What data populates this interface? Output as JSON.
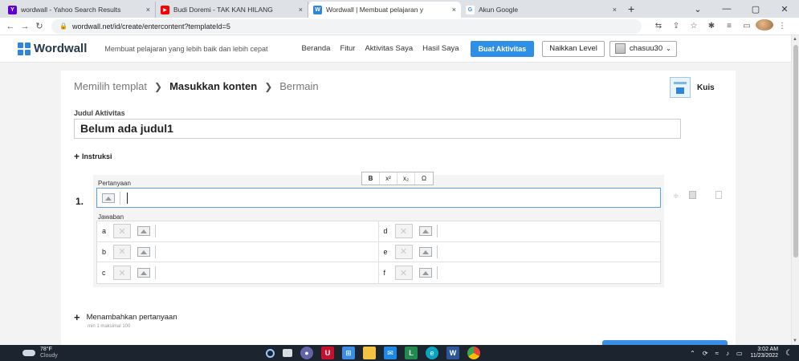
{
  "browser": {
    "tabs": [
      {
        "title": "wordwall - Yahoo Search Results",
        "fav_color": "#5f01d1",
        "fav_glyph": "Y"
      },
      {
        "title": "Budi Doremi - TAK KAN HILANG",
        "fav_color": "#ff0000",
        "fav_glyph": "▶"
      },
      {
        "title": "Wordwall | Membuat pelajaran y",
        "fav_color": "#2f86d9",
        "fav_glyph": "W",
        "active": true
      },
      {
        "title": "Akun Google",
        "fav_color": "#ffffff",
        "fav_glyph": "G"
      }
    ],
    "close_glyph": "×",
    "new_tab_glyph": "+",
    "url": "wordwall.net/id/create/entercontent?templateId=5",
    "window_controls": [
      "⌄",
      "—",
      "▢",
      "✕"
    ]
  },
  "header": {
    "logo": "Wordwall",
    "tagline": "Membuat pelajaran yang lebih baik dan lebih cepat",
    "nav": [
      "Beranda",
      "Fitur",
      "Aktivitas Saya",
      "Hasil Saya"
    ],
    "create_button": "Buat Aktivitas",
    "upgrade_button": "Naikkan Level",
    "user": "chasuu30"
  },
  "editor": {
    "breadcrumb": [
      "Memilih templat",
      "Masukkan konten",
      "Bermain"
    ],
    "template_name": "Kuis",
    "title_label": "Judul Aktivitas",
    "title_value": "Belum ada judul1",
    "instruction_label": "Instruksi",
    "question_label": "Pertanyaan",
    "question_number": "1.",
    "answer_label": "Jawaban",
    "answers": [
      "a",
      "d",
      "b",
      "e",
      "c",
      "f"
    ],
    "format_buttons": [
      "B",
      "x²",
      "x₂",
      "Ω"
    ],
    "add_question": "Menambahkan pertanyaan",
    "add_question_hint": "min 1   maksimal 100"
  },
  "taskbar": {
    "temp": "78°F",
    "weather": "Cloudy",
    "time": "3:02 AM",
    "date": "11/23/2022"
  },
  "colors": {
    "accent": "#2f8fe4",
    "logo_blue": "#2f86d9",
    "taskbar": "#1c2430"
  }
}
